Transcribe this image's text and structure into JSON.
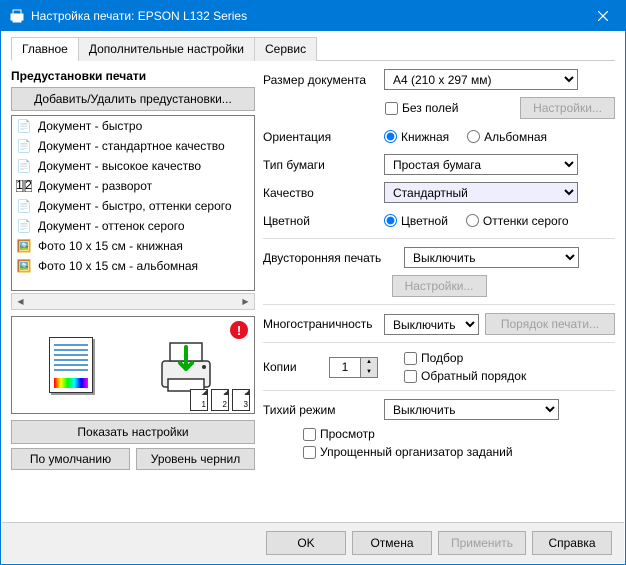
{
  "window": {
    "title": "Настройка печати: EPSON L132 Series"
  },
  "tabs": {
    "main": "Главное",
    "extra": "Дополнительные настройки",
    "service": "Сервис"
  },
  "left": {
    "heading": "Предустановки печати",
    "addRemove": "Добавить/Удалить предустановки...",
    "presets": [
      "Документ - быстро",
      "Документ - стандартное качество",
      "Документ - высокое качество",
      "Документ - разворот",
      "Документ - быстро, оттенки серого",
      "Документ - оттенок серого",
      "Фото 10 х 15 см - книжная",
      "Фото 10 х 15 см - альбомная"
    ],
    "showSettings": "Показать настройки",
    "defaults": "По умолчанию",
    "inkLevels": "Уровень чернил"
  },
  "right": {
    "docSizeLabel": "Размер документа",
    "docSize": "A4 (210 x 297 мм)",
    "borderless": "Без полей",
    "settingsBtn": "Настройки...",
    "orientationLabel": "Ориентация",
    "portrait": "Книжная",
    "landscape": "Альбомная",
    "paperTypeLabel": "Тип бумаги",
    "paperType": "Простая бумага",
    "qualityLabel": "Качество",
    "quality": "Стандартный",
    "colorLabel": "Цветной",
    "color": "Цветной",
    "grayscale": "Оттенки серого",
    "duplexLabel": "Двусторонняя печать",
    "duplex": "Выключить",
    "duplexSettings": "Настройки...",
    "multipageLabel": "Многостраничность",
    "multipage": "Выключить",
    "pageOrder": "Порядок печати...",
    "copiesLabel": "Копии",
    "copiesValue": "1",
    "collate": "Подбор",
    "reverseOrder": "Обратный порядок",
    "quietLabel": "Тихий режим",
    "quiet": "Выключить",
    "preview": "Просмотр",
    "simpleJob": "Упрощенный организатор заданий"
  },
  "footer": {
    "ok": "OK",
    "cancel": "Отмена",
    "apply": "Применить",
    "help": "Справка"
  }
}
